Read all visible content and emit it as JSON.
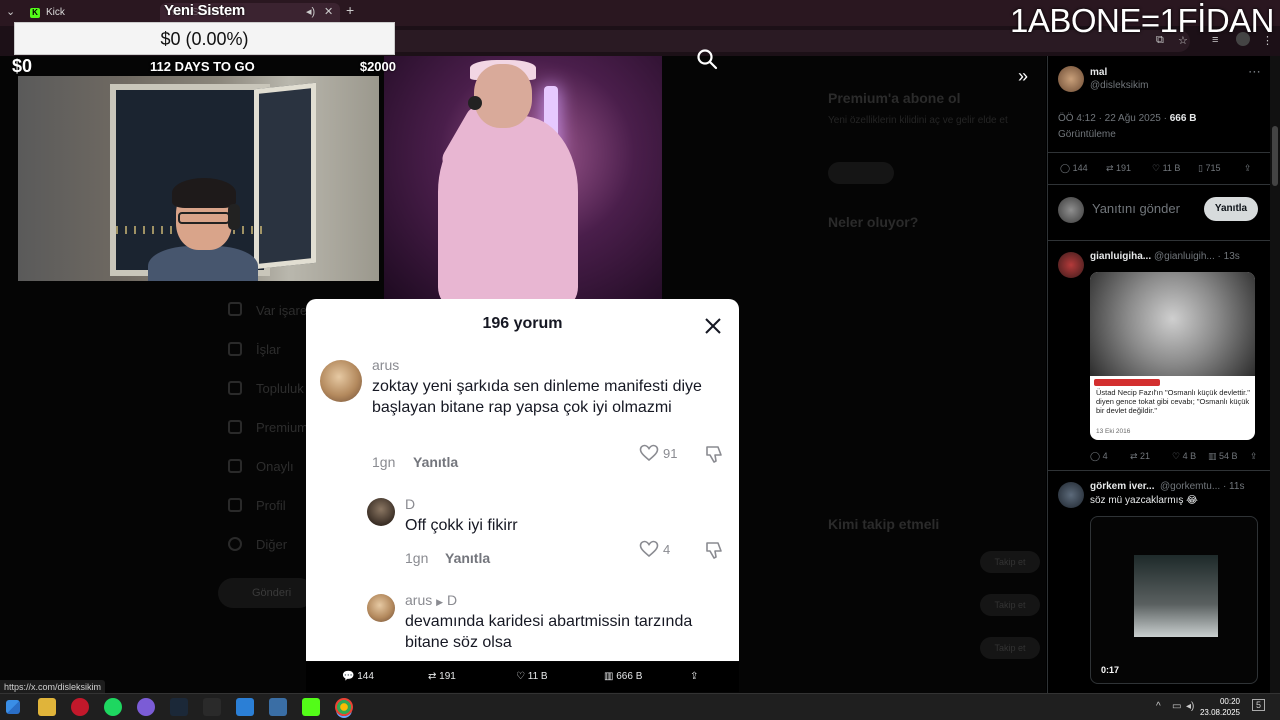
{
  "browser": {
    "tab_kick": "Kick",
    "tab_active": "Yeni Sistem | X",
    "new_tab": "+"
  },
  "overlay": {
    "stream_title": "Yeni Sistem",
    "headline": "1ABONE=1FİDAN",
    "donation_amount": "$0 (0.00%)",
    "goal_current": "$0",
    "goal_days": "112 DAYS TO GO",
    "goal_target": "$2000"
  },
  "x_sidebar": {
    "items": [
      "Var işareti",
      "İşlar",
      "Topluluk",
      "Premium",
      "Onaylı",
      "Profil",
      "Diğer"
    ],
    "post_label": "Gönderi"
  },
  "x_dim_right": {
    "premium_title": "Premium'a abone ol",
    "premium_text": "Yeni özelliklerin kilidini aç ve gelir elde et",
    "whats_happening": "Neler oluyor?",
    "who_to_follow": "Kimi takip etmeli",
    "follow_label": "Takip et"
  },
  "comments": {
    "title": "196 yorum",
    "list": [
      {
        "user": "arus",
        "text": "zoktay yeni şarkıda sen dinleme manifesti diye başlayan bitane rap yapsa çok iyi olmazmi",
        "time": "1gn",
        "reply": "Yanıtla",
        "likes": "91"
      },
      {
        "user": "D",
        "text": "Off çokk iyi fikirr",
        "time": "1gn",
        "reply": "Yanıtla",
        "likes": "4"
      },
      {
        "user": "arus",
        "reply_to": "D",
        "text": "devamında karidesi abartmissin tarzında bitane söz olsa"
      }
    ]
  },
  "tweet_stats_bottom": {
    "replies": "144",
    "reposts": "191",
    "likes": "11 B",
    "views": "666 B"
  },
  "x_panel": {
    "author_name": "mal",
    "author_handle": "@disleksikim",
    "timestamp": "ÖÖ 4:12 · 22 Ağu 2025 ·",
    "views_count": "666 B",
    "views_label": "Görüntüleme",
    "stats": {
      "replies": "144",
      "reposts": "191",
      "likes": "11 B",
      "bookmarks": "715"
    },
    "reply_placeholder": "Yanıtını gönder",
    "reply_button": "Yanıtla",
    "reply1": {
      "name": "gianluigiha...",
      "handle": "@gianluigih...",
      "time": "· 13s",
      "caption": "Üstad Necip Fazıl'ın \"Osmanlı küçük devlettir.\" diyen gence tokat gibi cevabı; \"Osmanlı küçük bir devlet değildir.\"",
      "date": "13 Eki 2016",
      "stats": {
        "replies": "4",
        "reposts": "21",
        "likes": "4 B",
        "views": "54 B"
      }
    },
    "reply2": {
      "name": "görkem iver...",
      "handle": "@gorkemtu...",
      "time": "· 11s",
      "text": "söz mü yazcaklarmış 😂",
      "video_time": "0:17"
    }
  },
  "status_url": "https://x.com/disleksikim",
  "taskbar": {
    "time": "00:20",
    "date": "23.08.2025",
    "notif_count": "5"
  },
  "colors": {
    "kick_green": "#53fc18",
    "x_bg": "#000000",
    "modal_bg": "#ffffff"
  }
}
